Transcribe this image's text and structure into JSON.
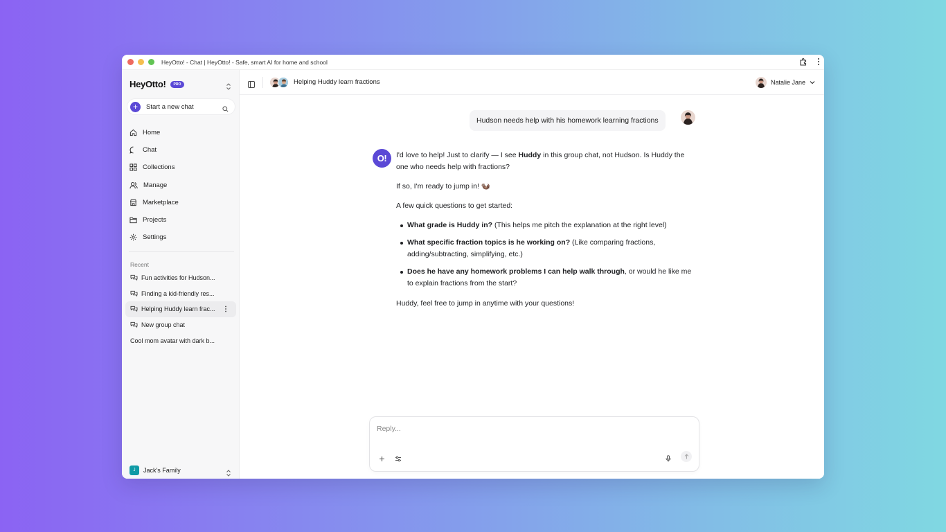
{
  "window": {
    "title": "HeyOtto! - Chat | HeyOtto! - Safe, smart AI for home and school",
    "traffic_colors": [
      "#ee6a5f",
      "#f5be4f",
      "#62c454"
    ]
  },
  "sidebar": {
    "brand": "HeyOtto!",
    "badge": "PRO",
    "new_chat_label": "Start a new chat",
    "nav": [
      {
        "label": "Home",
        "icon": "home-icon"
      },
      {
        "label": "Chat",
        "icon": "chat-icon"
      },
      {
        "label": "Collections",
        "icon": "collections-icon"
      },
      {
        "label": "Manage",
        "icon": "users-icon"
      },
      {
        "label": "Marketplace",
        "icon": "store-icon"
      },
      {
        "label": "Projects",
        "icon": "folder-icon"
      },
      {
        "label": "Settings",
        "icon": "gear-icon"
      }
    ],
    "recent_label": "Recent",
    "recent": [
      {
        "label": "Fun activities for Hudson...",
        "group": true
      },
      {
        "label": "Finding a kid-friendly res...",
        "group": true
      },
      {
        "label": "Helping Huddy learn frac...",
        "group": true,
        "active": true
      },
      {
        "label": "New group chat",
        "group": true
      },
      {
        "label": "Cool mom avatar with dark b...",
        "group": false
      }
    ],
    "family": {
      "initial": "J",
      "name": "Jack's Family"
    }
  },
  "header": {
    "chat_title": "Helping Huddy learn fractions",
    "user_name": "Natalie Jane"
  },
  "conversation": {
    "user_message": "Hudson needs help with his homework learning fractions",
    "assistant_logo": "O!",
    "assistant": {
      "p1_a": "I'd love to help! Just to clarify — I see ",
      "p1_b": "Huddy",
      "p1_c": " in this group chat, not Hudson. Is Huddy the one who needs help with fractions?",
      "p2": "If so, I'm ready to jump in! 🦦",
      "p3": "A few quick questions to get started:",
      "bullets": [
        {
          "bold": "What grade is Huddy in?",
          "rest": " (This helps me pitch the explanation at the right level)"
        },
        {
          "bold": "What specific fraction topics is he working on?",
          "rest": " (Like comparing fractions, adding/subtracting, simplifying, etc.)"
        },
        {
          "bold": "Does he have any homework problems I can help walk through",
          "rest": ", or would he like me to explain fractions from the start?"
        }
      ],
      "p4": "Huddy, feel free to jump in anytime with your questions!"
    }
  },
  "composer": {
    "placeholder": "Reply..."
  },
  "colors": {
    "accent": "#5b49d6",
    "family_avatar": "#0f9aa6"
  }
}
